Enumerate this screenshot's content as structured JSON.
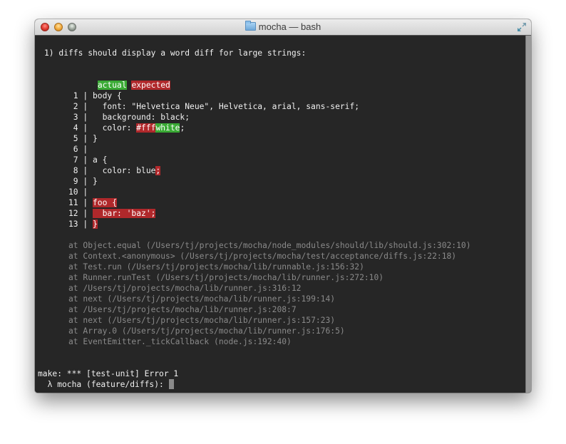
{
  "window": {
    "title": "mocha — bash",
    "buttons": {
      "close": "close",
      "minimize": "minimize",
      "zoom": "zoom"
    },
    "icons": {
      "title_icon": "folder-icon",
      "fullscreen_icon": "fullscreen-arrows-icon"
    }
  },
  "terminal": {
    "failure_heading": "1) diffs should display a word diff for large strings:",
    "legend": {
      "actual": "actual",
      "expected": "expected"
    },
    "colors": {
      "background": "#262626",
      "actual_green": "#3aaa35",
      "expected_red": "#b0282b",
      "stack_gray": "#8a8a8a",
      "text": "#f0f0f0"
    },
    "diff_lines": [
      {
        "num": "1",
        "segments": [
          {
            "text": "body {",
            "type": "plain"
          }
        ]
      },
      {
        "num": "2",
        "segments": [
          {
            "text": "  font: \"Helvetica Neue\", Helvetica, arial, sans-serif;",
            "type": "plain"
          }
        ]
      },
      {
        "num": "3",
        "segments": [
          {
            "text": "  background: black;",
            "type": "plain"
          }
        ]
      },
      {
        "num": "4",
        "segments": [
          {
            "text": "  color: ",
            "type": "plain"
          },
          {
            "text": "#fff",
            "type": "expected"
          },
          {
            "text": "white",
            "type": "actual"
          },
          {
            "text": ";",
            "type": "plain"
          }
        ]
      },
      {
        "num": "5",
        "segments": [
          {
            "text": "}",
            "type": "plain"
          }
        ]
      },
      {
        "num": "6",
        "segments": []
      },
      {
        "num": "7",
        "segments": [
          {
            "text": "a {",
            "type": "plain"
          }
        ]
      },
      {
        "num": "8",
        "segments": [
          {
            "text": "  color: blue",
            "type": "plain"
          },
          {
            "text": ";",
            "type": "expected"
          }
        ]
      },
      {
        "num": "9",
        "segments": [
          {
            "text": "}",
            "type": "plain"
          }
        ]
      },
      {
        "num": "10",
        "segments": []
      },
      {
        "num": "11",
        "segments": [
          {
            "text": "foo {",
            "type": "expected"
          }
        ]
      },
      {
        "num": "12",
        "segments": [
          {
            "text": "  bar: 'baz';",
            "type": "expected"
          }
        ]
      },
      {
        "num": "13",
        "segments": [
          {
            "text": "}",
            "type": "expected"
          }
        ]
      }
    ],
    "stack_trace": [
      "at Object.equal (/Users/tj/projects/mocha/node_modules/should/lib/should.js:302:10)",
      "at Context.<anonymous> (/Users/tj/projects/mocha/test/acceptance/diffs.js:22:18)",
      "at Test.run (/Users/tj/projects/mocha/lib/runnable.js:156:32)",
      "at Runner.runTest (/Users/tj/projects/mocha/lib/runner.js:272:10)",
      "at /Users/tj/projects/mocha/lib/runner.js:316:12",
      "at next (/Users/tj/projects/mocha/lib/runner.js:199:14)",
      "at /Users/tj/projects/mocha/lib/runner.js:208:7",
      "at next (/Users/tj/projects/mocha/lib/runner.js:157:23)",
      "at Array.0 (/Users/tj/projects/mocha/lib/runner.js:176:5)",
      "at EventEmitter._tickCallback (node.js:192:40)"
    ],
    "make_error": "make: *** [test-unit] Error 1",
    "prompt": "  λ mocha (feature/diffs): "
  }
}
